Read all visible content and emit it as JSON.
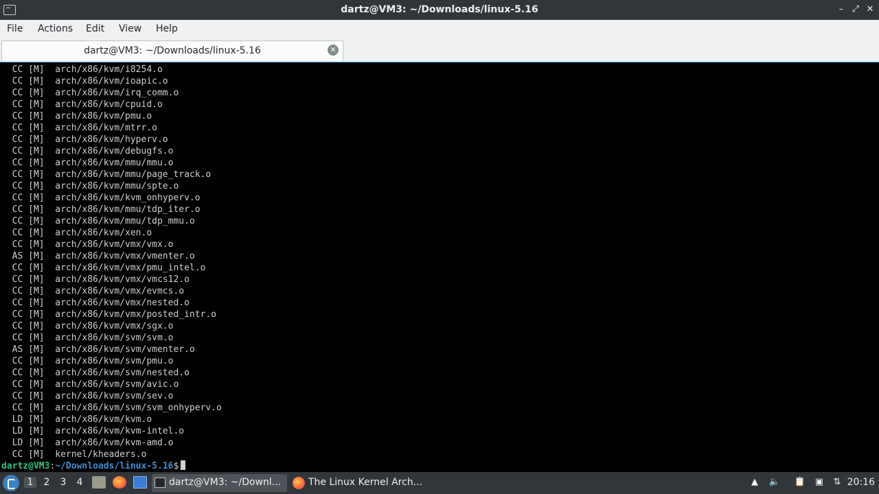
{
  "window": {
    "title": "dartz@VM3: ~/Downloads/linux-5.16"
  },
  "menu": [
    "File",
    "Actions",
    "Edit",
    "View",
    "Help"
  ],
  "tab": {
    "label": "dartz@VM3: ~/Downloads/linux-5.16"
  },
  "terminal": {
    "lines": [
      "  CC [M]  arch/x86/kvm/i8254.o",
      "  CC [M]  arch/x86/kvm/ioapic.o",
      "  CC [M]  arch/x86/kvm/irq_comm.o",
      "  CC [M]  arch/x86/kvm/cpuid.o",
      "  CC [M]  arch/x86/kvm/pmu.o",
      "  CC [M]  arch/x86/kvm/mtrr.o",
      "  CC [M]  arch/x86/kvm/hyperv.o",
      "  CC [M]  arch/x86/kvm/debugfs.o",
      "  CC [M]  arch/x86/kvm/mmu/mmu.o",
      "  CC [M]  arch/x86/kvm/mmu/page_track.o",
      "  CC [M]  arch/x86/kvm/mmu/spte.o",
      "  CC [M]  arch/x86/kvm/kvm_onhyperv.o",
      "  CC [M]  arch/x86/kvm/mmu/tdp_iter.o",
      "  CC [M]  arch/x86/kvm/mmu/tdp_mmu.o",
      "  CC [M]  arch/x86/kvm/xen.o",
      "  CC [M]  arch/x86/kvm/vmx/vmx.o",
      "  AS [M]  arch/x86/kvm/vmx/vmenter.o",
      "  CC [M]  arch/x86/kvm/vmx/pmu_intel.o",
      "  CC [M]  arch/x86/kvm/vmx/vmcs12.o",
      "  CC [M]  arch/x86/kvm/vmx/evmcs.o",
      "  CC [M]  arch/x86/kvm/vmx/nested.o",
      "  CC [M]  arch/x86/kvm/vmx/posted_intr.o",
      "  CC [M]  arch/x86/kvm/vmx/sgx.o",
      "  CC [M]  arch/x86/kvm/svm/svm.o",
      "  AS [M]  arch/x86/kvm/svm/vmenter.o",
      "  CC [M]  arch/x86/kvm/svm/pmu.o",
      "  CC [M]  arch/x86/kvm/svm/nested.o",
      "  CC [M]  arch/x86/kvm/svm/avic.o",
      "  CC [M]  arch/x86/kvm/svm/sev.o",
      "  CC [M]  arch/x86/kvm/svm/svm_onhyperv.o",
      "  LD [M]  arch/x86/kvm/kvm.o",
      "  LD [M]  arch/x86/kvm/kvm-intel.o",
      "  LD [M]  arch/x86/kvm/kvm-amd.o",
      "  CC [M]  kernel/kheaders.o"
    ],
    "prompt_user": "dartz@VM3",
    "prompt_sep": ":",
    "prompt_path": "~/Downloads/linux-5.16",
    "prompt_symbol": "$"
  },
  "taskbar": {
    "workspaces": [
      "1",
      "2",
      "3",
      "4"
    ],
    "tasks": [
      {
        "label": "dartz@VM3: ~/Downl...",
        "icon": "terminal-icon"
      },
      {
        "label": "The Linux Kernel Arch...",
        "icon": "firefox-icon"
      }
    ],
    "clock": "20:16"
  }
}
